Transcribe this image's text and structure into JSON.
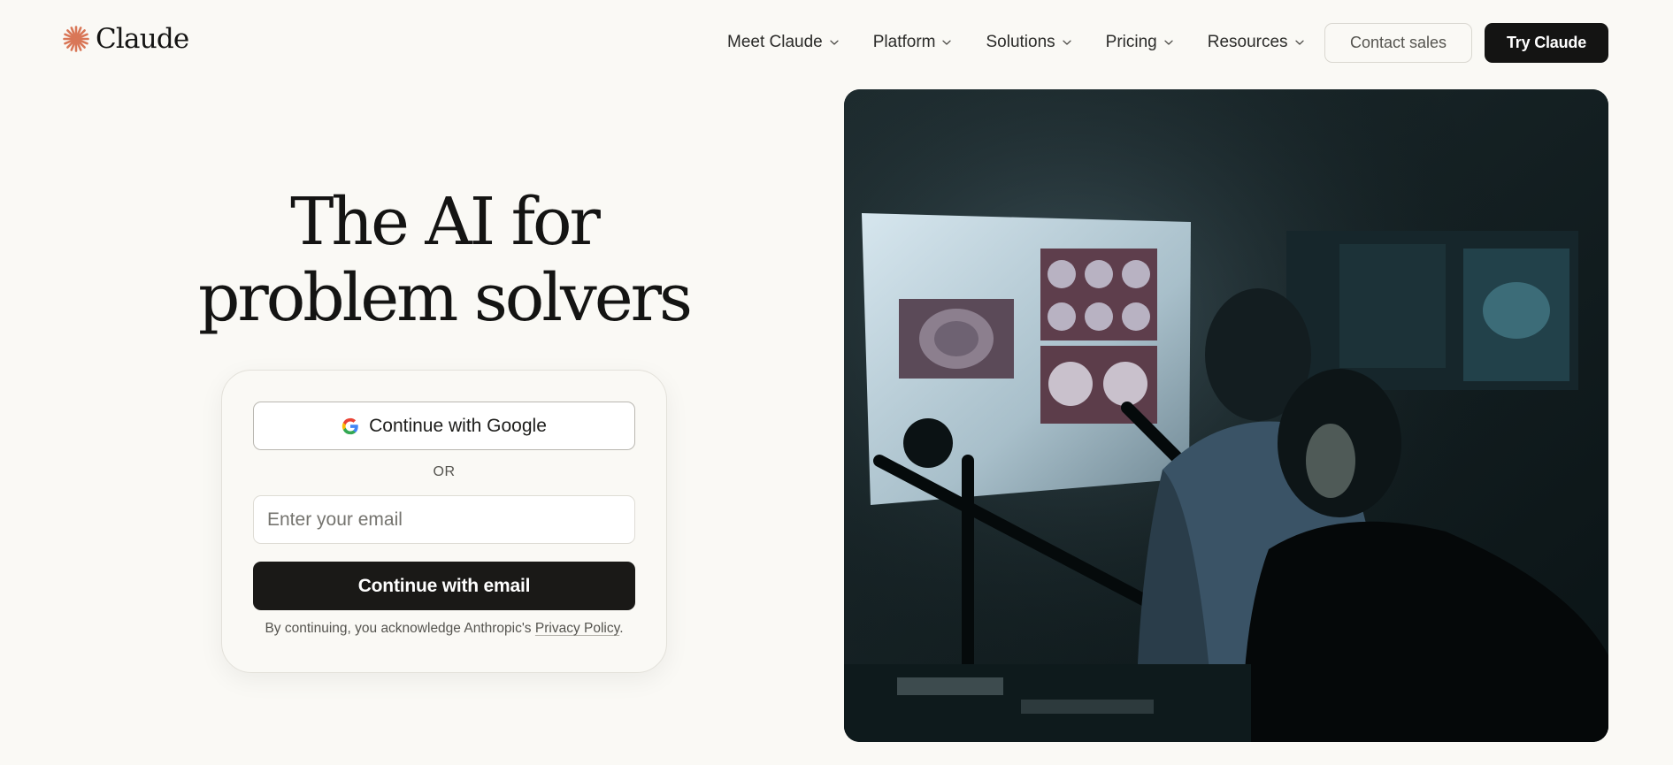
{
  "brand": {
    "name": "Claude",
    "accent_color": "#d97757",
    "logo_icon": "claude-starburst-icon"
  },
  "nav": {
    "items": [
      {
        "label": "Meet Claude",
        "icon": "chevron-down-icon"
      },
      {
        "label": "Platform",
        "icon": "chevron-down-icon"
      },
      {
        "label": "Solutions",
        "icon": "chevron-down-icon"
      },
      {
        "label": "Pricing",
        "icon": "chevron-down-icon"
      },
      {
        "label": "Resources",
        "icon": "chevron-down-icon"
      }
    ],
    "contact_label": "Contact sales",
    "try_label": "Try Claude"
  },
  "hero": {
    "headline_line1": "The AI for",
    "headline_line2": "problem solvers"
  },
  "signin": {
    "google_label": "Continue with Google",
    "google_icon": "google-icon",
    "or_label": "OR",
    "email_placeholder": "Enter your email",
    "email_value": "",
    "email_button_label": "Continue with email",
    "legal_prefix": "By continuing, you acknowledge Anthropic's ",
    "legal_link": "Privacy Policy",
    "legal_suffix": "."
  },
  "colors": {
    "background": "#faf9f5",
    "primary_button": "#141413",
    "text": "#141413",
    "muted_text": "#55544f"
  }
}
